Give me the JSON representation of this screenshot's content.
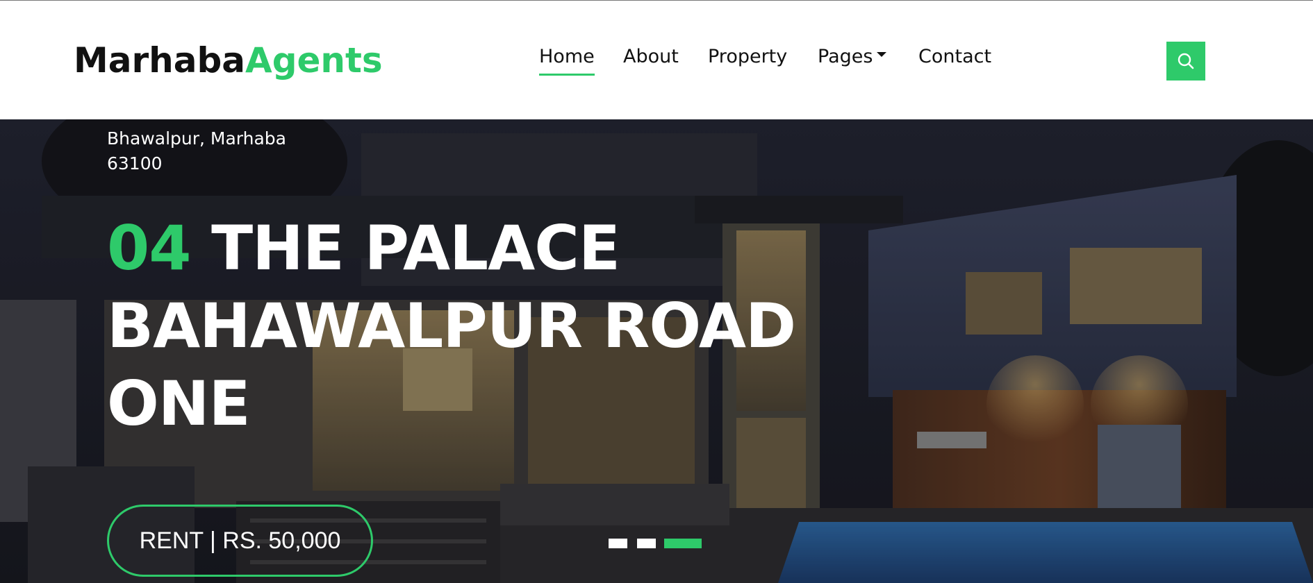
{
  "brand": {
    "name_part1": "Marhaba",
    "name_part2": "Agents",
    "accent_color": "#2eca6a"
  },
  "nav": {
    "items": [
      {
        "label": "Home",
        "active": true
      },
      {
        "label": "About"
      },
      {
        "label": "Property"
      },
      {
        "label": "Pages",
        "has_dropdown": true
      },
      {
        "label": "Contact"
      }
    ],
    "search_icon": "search-icon"
  },
  "hero": {
    "address_line1": "Bhawalpur, Marhaba",
    "address_line2": "63100",
    "title_number": "04",
    "title_line1_rest": " THE PALACE",
    "title_line2": "BAHAWALPUR ROAD",
    "title_line3": "ONE",
    "price_label": "RENT | RS. 50,000",
    "carousel": {
      "slide_count": 3,
      "active_slide": 3
    }
  }
}
